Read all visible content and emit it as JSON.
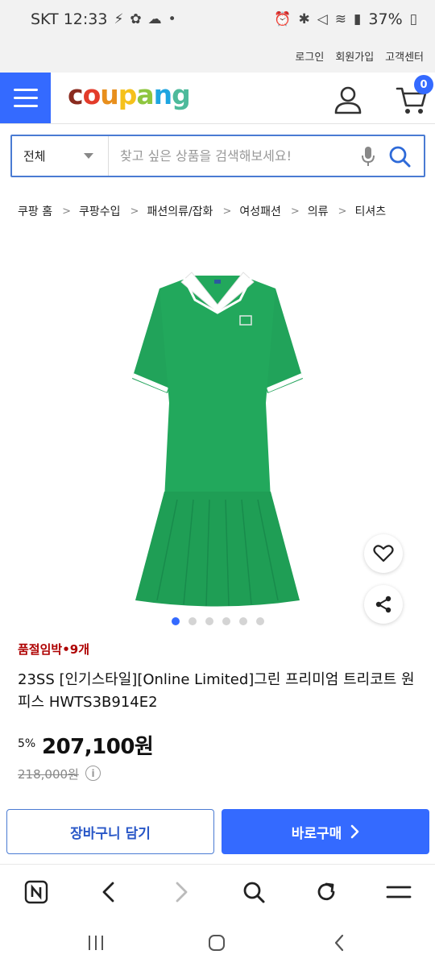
{
  "status_bar": {
    "carrier_time": "SKT 12:33",
    "battery": "37%"
  },
  "top_links": [
    "로그인",
    "회원가입",
    "고객센터"
  ],
  "header": {
    "logo_text": "coupang",
    "cart_count": "0"
  },
  "search": {
    "category": "전체",
    "placeholder": "찾고 싶은 상품을 검색해보세요!"
  },
  "breadcrumb": [
    "쿠팡 홈",
    "쿠팡수입",
    "패션의류/잡화",
    "여성패션",
    "의류",
    "티셔츠"
  ],
  "gallery": {
    "image_count": 6,
    "active_index": 0
  },
  "product": {
    "stock_badge": "품절임박•9개",
    "title": "23SS [인기스타일][Online Limited]그린 프리미엄 트리코트 원피스 HWTS3B914E2",
    "discount": "5%",
    "price": "207,100원",
    "original_price": "218,000원"
  },
  "buttons": {
    "cart": "장바구니 담기",
    "buy": "바로구매"
  },
  "colors": {
    "accent": "#346aff",
    "badge_red": "#ae0000",
    "dress_green": "#21a35a"
  },
  "icons": {
    "browser_bar": [
      "n-badge-icon",
      "back-icon",
      "forward-icon",
      "search-icon",
      "reload-icon",
      "menu-icon"
    ],
    "nav_bar": [
      "recents-icon",
      "home-icon",
      "back-icon"
    ]
  }
}
